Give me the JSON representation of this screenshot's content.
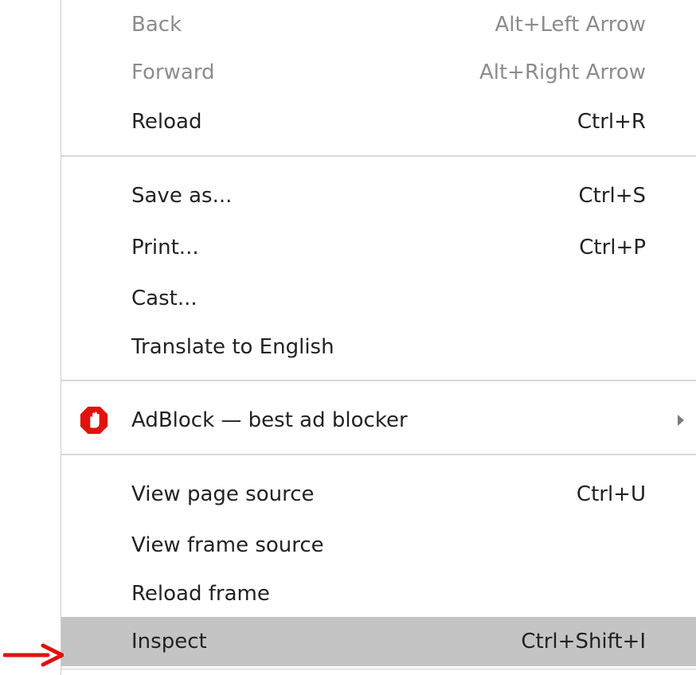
{
  "menu": {
    "back": {
      "label": "Back",
      "shortcut": "Alt+Left Arrow"
    },
    "forward": {
      "label": "Forward",
      "shortcut": "Alt+Right Arrow"
    },
    "reload": {
      "label": "Reload",
      "shortcut": "Ctrl+R"
    },
    "save_as": {
      "label": "Save as...",
      "shortcut": "Ctrl+S"
    },
    "print": {
      "label": "Print...",
      "shortcut": "Ctrl+P"
    },
    "cast": {
      "label": "Cast..."
    },
    "translate": {
      "label": "Translate to English"
    },
    "adblock": {
      "label": "AdBlock — best ad blocker",
      "icon": "adblock-hand-icon",
      "icon_color": "#e0120f"
    },
    "view_source": {
      "label": "View page source",
      "shortcut": "Ctrl+U"
    },
    "view_frame_source": {
      "label": "View frame source"
    },
    "reload_frame": {
      "label": "Reload frame"
    },
    "inspect": {
      "label": "Inspect",
      "shortcut": "Ctrl+Shift+I",
      "highlighted": true
    }
  },
  "annotation": {
    "pointer_color": "#e0120f"
  },
  "colors": {
    "highlight": "#c4c4c4",
    "disabled_text": "#8c8c8c",
    "text": "#222222"
  }
}
